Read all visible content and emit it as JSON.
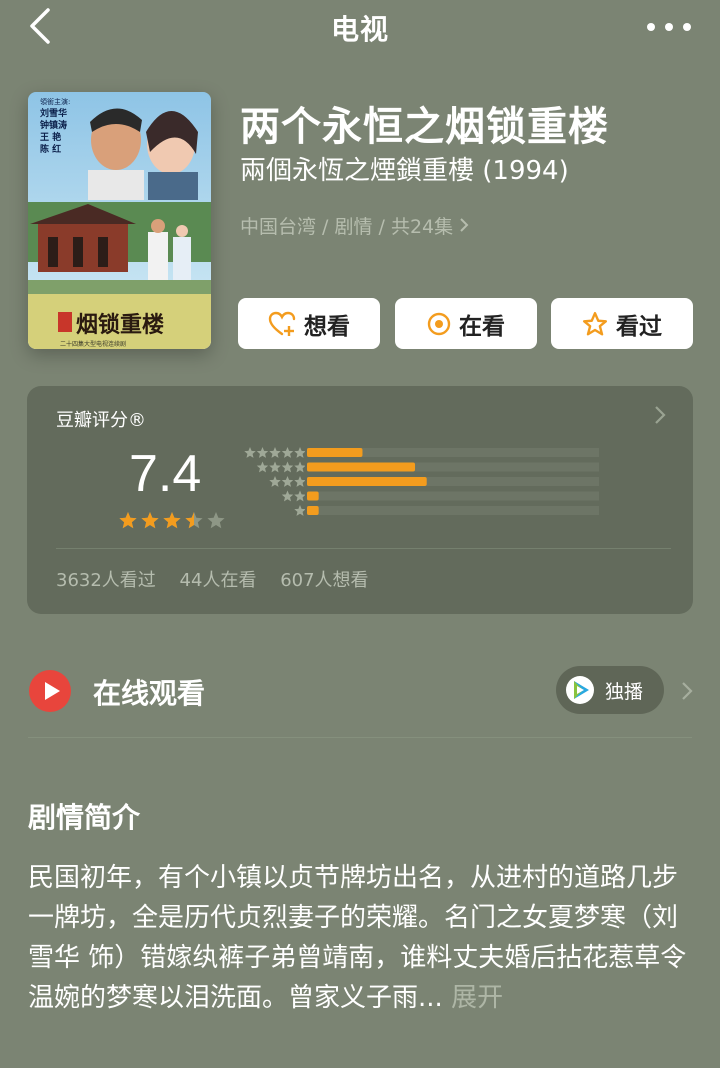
{
  "nav": {
    "title": "电视"
  },
  "movie": {
    "title": "两个永恒之烟锁重楼",
    "subtitle": "兩個永恆之煙鎖重樓 (1994)",
    "meta": "中国台湾 / 剧情 / 共24集",
    "poster": {
      "credit_label": "領銜主演:",
      "cast": [
        "刘雪华",
        "钟镇涛",
        "王  艳",
        "陈  红"
      ],
      "logo_text": "烟锁重楼",
      "tagline": "二十四集大型电视连续剧"
    }
  },
  "actions": {
    "want": "想看",
    "watching": "在看",
    "watched": "看过"
  },
  "rating": {
    "label": "豆瓣评分®",
    "score": "7.4",
    "stars": 3.5,
    "distribution": [
      0.19,
      0.37,
      0.41,
      0.04,
      0.04
    ],
    "counts": {
      "watched": "3632人看过",
      "watching": "44人在看",
      "want": "607人想看"
    }
  },
  "watch": {
    "title": "在线观看",
    "badge_label": "独播"
  },
  "summary": {
    "title": "剧情简介",
    "text": "民国初年，有个小镇以贞节牌坊出名，从进村的道路几步一牌坊，全是历代贞烈妻子的荣耀。名门之女夏梦寒（刘雪华 饰）错嫁纨裤子弟曾靖南，谁料丈夫婚后拈花惹草令温婉的梦寒以泪洗面。曾家义子雨...",
    "expand_label": "展开"
  },
  "colors": {
    "background": "#7b8473",
    "card": "#636b5c",
    "accent_orange": "#f39c1e",
    "play_red": "#e8453c"
  }
}
